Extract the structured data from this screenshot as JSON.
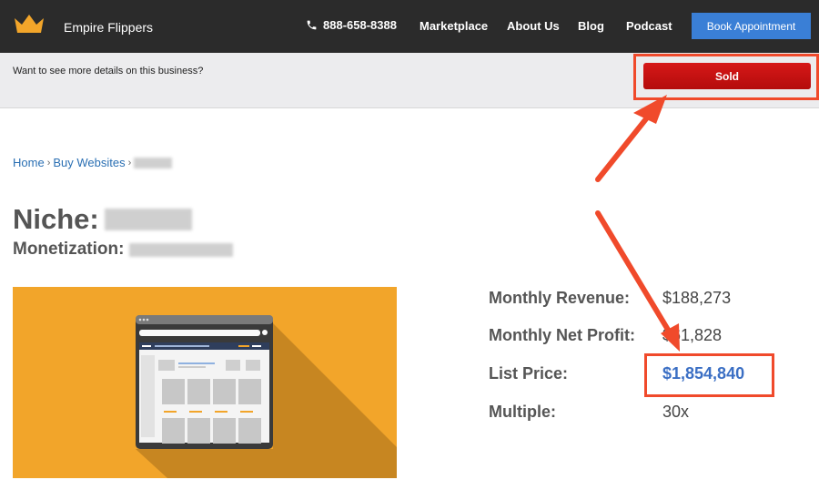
{
  "nav": {
    "brand": "Empire Flippers",
    "phone": "888-658-8388",
    "links": [
      "Marketplace",
      "About Us",
      "Blog",
      "Podcast"
    ],
    "book_label": "Book Appointment",
    "icons": {
      "logo": "crown-logo-icon",
      "phone": "phone-icon"
    }
  },
  "infobar": {
    "text": "Want to see more details on this business?",
    "sold_label": "Sold"
  },
  "breadcrumb": {
    "home": "Home",
    "buy": "Buy Websites",
    "sep": "›"
  },
  "listing": {
    "niche_label": "Niche:",
    "monetization_label": "Monetization:"
  },
  "stats": [
    {
      "label": "Monthly Revenue:",
      "value": "$188,273"
    },
    {
      "label": "Monthly Net Profit:",
      "value": "$61,828"
    },
    {
      "label": "List Price:",
      "value": "$1,854,840"
    },
    {
      "label": "Multiple:",
      "value": "30x"
    }
  ],
  "colors": {
    "nav_bg": "#2b2b2b",
    "book_button": "#3a7fd6",
    "sold_button": "#c81010",
    "annotation": "#f04a2b",
    "price": "#3b6fc4",
    "hero_bg": "#f2a52a"
  }
}
